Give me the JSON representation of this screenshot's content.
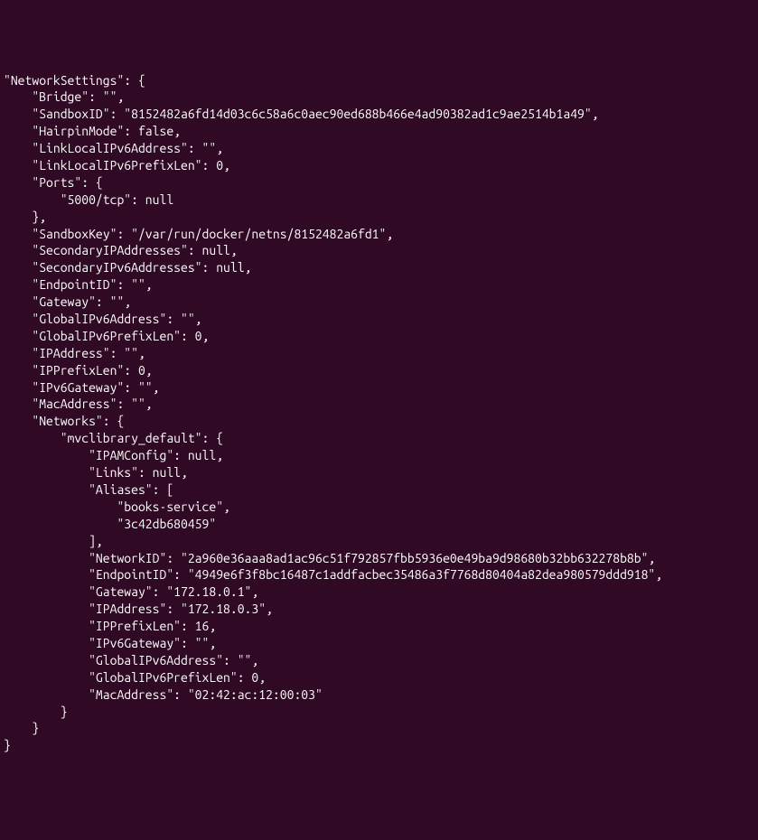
{
  "terminal": {
    "lines": [
      "\"NetworkSettings\": {",
      "    \"Bridge\": \"\",",
      "    \"SandboxID\": \"8152482a6fd14d03c6c58a6c0aec90ed688b466e4ad90382ad1c9ae2514b1a49\",",
      "    \"HairpinMode\": false,",
      "    \"LinkLocalIPv6Address\": \"\",",
      "    \"LinkLocalIPv6PrefixLen\": 0,",
      "    \"Ports\": {",
      "        \"5000/tcp\": null",
      "    },",
      "    \"SandboxKey\": \"/var/run/docker/netns/8152482a6fd1\",",
      "    \"SecondaryIPAddresses\": null,",
      "    \"SecondaryIPv6Addresses\": null,",
      "    \"EndpointID\": \"\",",
      "    \"Gateway\": \"\",",
      "    \"GlobalIPv6Address\": \"\",",
      "    \"GlobalIPv6PrefixLen\": 0,",
      "    \"IPAddress\": \"\",",
      "    \"IPPrefixLen\": 0,",
      "    \"IPv6Gateway\": \"\",",
      "    \"MacAddress\": \"\",",
      "    \"Networks\": {",
      "        \"mvclibrary_default\": {",
      "            \"IPAMConfig\": null,",
      "            \"Links\": null,",
      "            \"Aliases\": [",
      "                \"books-service\",",
      "                \"3c42db680459\"",
      "            ],",
      "            \"NetworkID\": \"2a960e36aaa8ad1ac96c51f792857fbb5936e0e49ba9d98680b32bb632278b8b\",",
      "            \"EndpointID\": \"4949e6f3f8bc16487c1addfacbec35486a3f7768d80404a82dea980579ddd918\",",
      "            \"Gateway\": \"172.18.0.1\",",
      "            \"IPAddress\": \"172.18.0.3\",",
      "            \"IPPrefixLen\": 16,",
      "            \"IPv6Gateway\": \"\",",
      "            \"GlobalIPv6Address\": \"\",",
      "            \"GlobalIPv6PrefixLen\": 0,",
      "            \"MacAddress\": \"02:42:ac:12:00:03\"",
      "        }",
      "    }",
      "}"
    ]
  }
}
